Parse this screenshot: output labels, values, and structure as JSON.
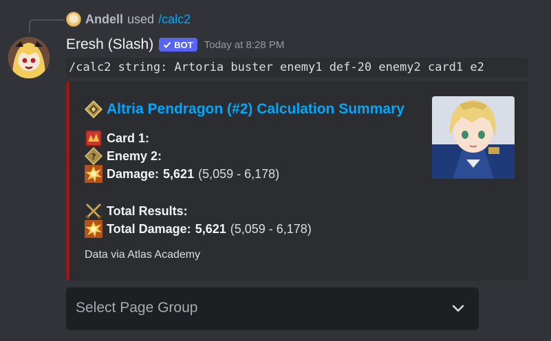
{
  "reply": {
    "user": "Andell",
    "used_text": "used",
    "command": "/calc2"
  },
  "message": {
    "username": "Eresh (Slash)",
    "bot_badge": "BOT",
    "timestamp": "Today at 8:28 PM",
    "command_text": "/calc2 string: Artoria buster enemy1 def-20 enemy2 card1 e2"
  },
  "embed": {
    "accent_color": "#8e1c1c",
    "title": "Altria Pendragon (#2) Calculation Summary",
    "title_icon": "class-diamond-icon",
    "card_label": "Card 1:",
    "card_icon": "buster-card-icon",
    "enemy_label": "Enemy 2:",
    "enemy_icon": "enemy-class-icon",
    "damage_label": "Damage:",
    "damage_value": "5,621",
    "damage_range": "(5,059 - 6,178)",
    "damage_icon": "explosion-icon",
    "total_results_label": "Total Results:",
    "total_results_icon": "crossed-swords-icon",
    "total_damage_label": "Total Damage:",
    "total_damage_value": "5,621",
    "total_damage_range": "(5,059 - 6,178)",
    "total_damage_icon": "explosion-icon",
    "footer": "Data via Atlas Academy"
  },
  "select": {
    "placeholder": "Select Page Group"
  }
}
